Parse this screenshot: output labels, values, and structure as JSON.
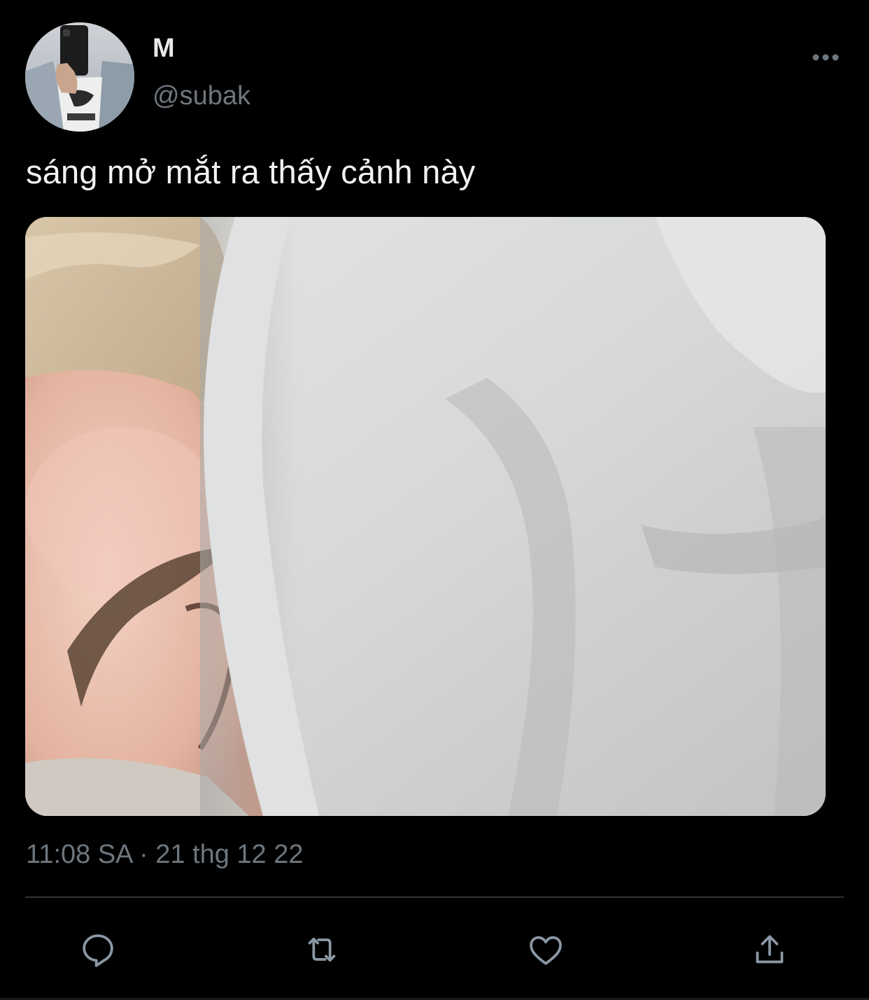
{
  "tweet": {
    "display_name": "M",
    "handle": "@subak",
    "text": "sáng mở mắt ra thấy cảnh này",
    "time": "11:08 SA",
    "separator": "·",
    "date": "21 thg 12 22"
  },
  "icons": {
    "more": "more-horizontal-icon",
    "reply": "reply-icon",
    "retweet": "retweet-icon",
    "like": "heart-icon",
    "share": "share-icon"
  },
  "colors": {
    "background": "#000000",
    "primary_text": "#e7e9ea",
    "secondary_text": "#6e767d",
    "divider": "#2f3336",
    "icon": "#8b98a5"
  }
}
